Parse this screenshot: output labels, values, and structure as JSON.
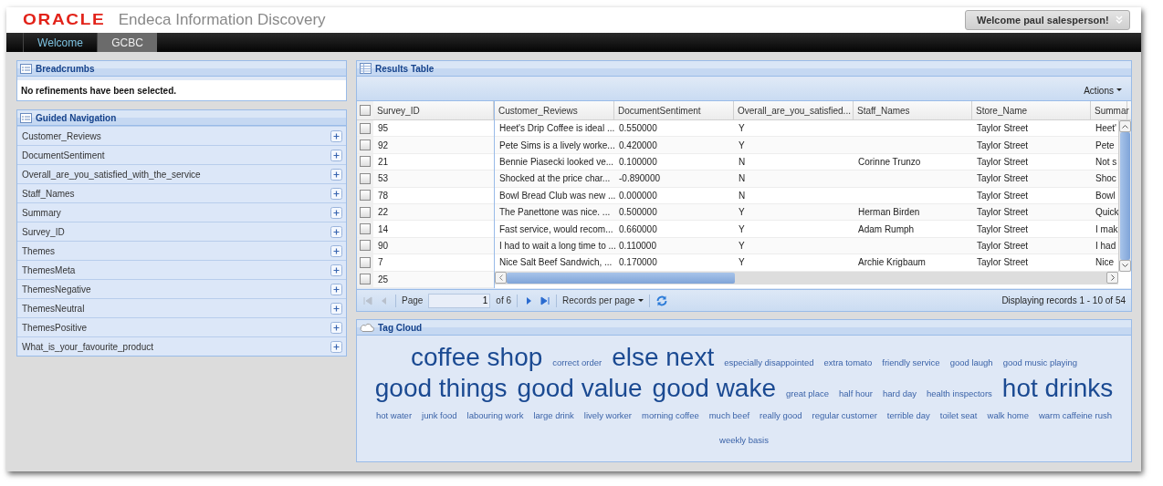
{
  "header": {
    "logo": "ORACLE",
    "product": "Endeca Information Discovery",
    "user_menu": "Welcome paul salesperson!"
  },
  "tabs": [
    {
      "label": "Welcome",
      "selected": false
    },
    {
      "label": "GCBC",
      "selected": true
    }
  ],
  "breadcrumbs": {
    "title": "Breadcrumbs",
    "message": "No refinements have been selected."
  },
  "guided_navigation": {
    "title": "Guided Navigation",
    "items": [
      {
        "label": "Customer_Reviews",
        "expanded": false
      },
      {
        "label": "DocumentSentiment",
        "expanded": false
      },
      {
        "label": "Overall_are_you_satisfied_with_the_service",
        "expanded": false
      },
      {
        "label": "Staff_Names",
        "expanded": false
      },
      {
        "label": "Summary",
        "expanded": false
      },
      {
        "label": "Survey_ID",
        "expanded": false
      },
      {
        "label": "Themes",
        "expanded": false
      },
      {
        "label": "ThemesMeta",
        "expanded": false
      },
      {
        "label": "ThemesNegative",
        "expanded": false
      },
      {
        "label": "ThemesNeutral",
        "expanded": false
      },
      {
        "label": "ThemesPositive",
        "expanded": false
      },
      {
        "label": "What_is_your_favourite_product",
        "expanded": false
      }
    ]
  },
  "results_table": {
    "title": "Results Table",
    "actions": "Actions",
    "header_checked": false,
    "columns": [
      "Survey_ID",
      "Customer_Reviews",
      "DocumentSentiment",
      "Overall_are_you_satisfied...",
      "Staff_Names",
      "Store_Name",
      "Summar"
    ],
    "rows": [
      {
        "checked": false,
        "cells": [
          "95",
          "Heet's Drip Coffee is ideal ...",
          "0.550000",
          "Y",
          "",
          "Taylor Street",
          "Heet'"
        ]
      },
      {
        "checked": false,
        "cells": [
          "92",
          "Pete Sims is a lively worke...",
          "0.420000",
          "Y",
          "",
          "Taylor Street",
          "Pete"
        ]
      },
      {
        "checked": false,
        "cells": [
          "21",
          "Bennie Piasecki looked ve...",
          "0.100000",
          "N",
          "Corinne Trunzo",
          "Taylor Street",
          "Not s"
        ]
      },
      {
        "checked": false,
        "cells": [
          "53",
          "Shocked at the price char...",
          "-0.890000",
          "N",
          "",
          "Taylor Street",
          "Shoc"
        ]
      },
      {
        "checked": false,
        "cells": [
          "78",
          "Bowl Bread Club was new ...",
          "0.000000",
          "N",
          "",
          "Taylor Street",
          "Bowl"
        ]
      },
      {
        "checked": false,
        "cells": [
          "22",
          "The Panettone was nice. ...",
          "0.500000",
          "Y",
          "Herman Birden",
          "Taylor Street",
          "Quick"
        ]
      },
      {
        "checked": false,
        "cells": [
          "14",
          "Fast service, would recom...",
          "0.660000",
          "Y",
          "Adam Rumph",
          "Taylor Street",
          "I mak"
        ]
      },
      {
        "checked": false,
        "cells": [
          "90",
          "I had to wait a long time to ...",
          "0.110000",
          "Y",
          "",
          "Taylor Street",
          "I had"
        ]
      },
      {
        "checked": false,
        "cells": [
          "7",
          "Nice Salt Beef Sandwich, ...",
          "0.170000",
          "Y",
          "Archie Krigbaum",
          "Taylor Street",
          "Nice"
        ]
      },
      {
        "checked": false,
        "cells": [
          "25"
        ]
      }
    ],
    "pager": {
      "first_disabled": true,
      "prev_disabled": true,
      "next_disabled": false,
      "last_disabled": false,
      "page_label": "Page",
      "page_value": "1",
      "page_count": "of 6",
      "records_per_page": "Records per page",
      "status": "Displaying records 1 - 10 of 54"
    }
  },
  "tag_cloud": {
    "title": "Tag Cloud",
    "lines": [
      [
        {
          "text": "coffee shop",
          "kind": "large"
        },
        {
          "text": "correct order",
          "kind": "small"
        },
        {
          "text": "else next",
          "kind": "large"
        },
        {
          "text": "especially disappointed",
          "kind": "small"
        },
        {
          "text": "extra tomato",
          "kind": "small"
        },
        {
          "text": "friendly service",
          "kind": "small"
        },
        {
          "text": "good laugh",
          "kind": "small"
        },
        {
          "text": "good music playing",
          "kind": "small"
        }
      ],
      [
        {
          "text": "good things",
          "kind": "large"
        },
        {
          "text": "good value",
          "kind": "large"
        },
        {
          "text": "good wake",
          "kind": "large"
        },
        {
          "text": "great place",
          "kind": "small"
        },
        {
          "text": "half hour",
          "kind": "small"
        },
        {
          "text": "hard day",
          "kind": "small"
        },
        {
          "text": "health inspectors",
          "kind": "small"
        },
        {
          "text": "hot drinks",
          "kind": "large"
        }
      ],
      [
        {
          "text": "hot water",
          "kind": "small"
        },
        {
          "text": "junk food",
          "kind": "small"
        },
        {
          "text": "labouring work",
          "kind": "small"
        },
        {
          "text": "large drink",
          "kind": "small"
        },
        {
          "text": "lively worker",
          "kind": "small"
        },
        {
          "text": "morning coffee",
          "kind": "small"
        },
        {
          "text": "much beef",
          "kind": "small"
        },
        {
          "text": "really good",
          "kind": "small"
        },
        {
          "text": "regular customer",
          "kind": "small"
        },
        {
          "text": "terrible day",
          "kind": "small"
        },
        {
          "text": "toilet seat",
          "kind": "small"
        },
        {
          "text": "walk home",
          "kind": "small"
        },
        {
          "text": "warm caffeine rush",
          "kind": "small"
        }
      ],
      [
        {
          "text": "weekly basis",
          "kind": "small"
        }
      ]
    ]
  }
}
